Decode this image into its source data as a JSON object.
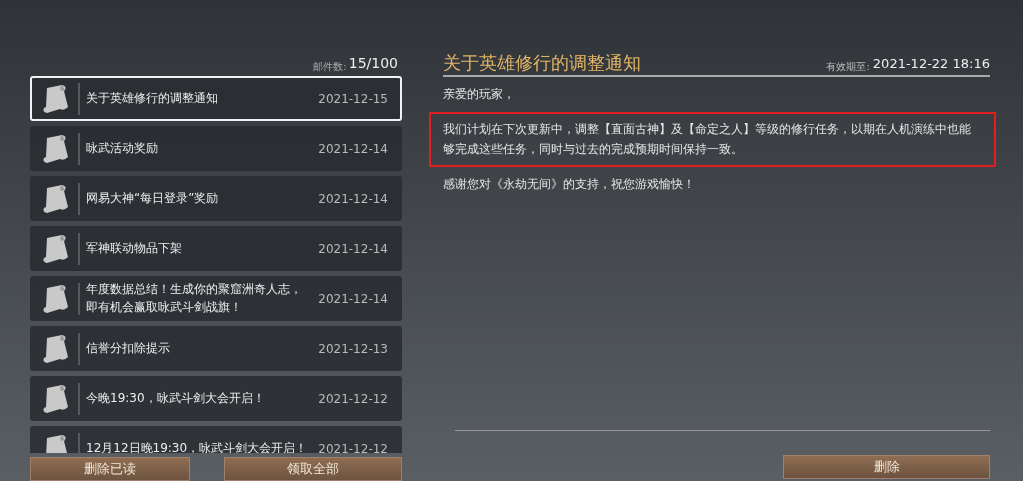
{
  "mail_list": {
    "count_label": "邮件数:",
    "count": "15/100",
    "items": [
      {
        "title": "关于英雄修行的调整通知",
        "date": "2021-12-15",
        "selected": true
      },
      {
        "title": "咏武活动奖励",
        "date": "2021-12-14",
        "selected": false
      },
      {
        "title": "网易大神“每日登录”奖励",
        "date": "2021-12-14",
        "selected": false
      },
      {
        "title": "军神联动物品下架",
        "date": "2021-12-14",
        "selected": false
      },
      {
        "title": "年度数据总结！生成你的聚窟洲奇人志，即有机会赢取咏武斗剑战旗！",
        "date": "2021-12-14",
        "selected": false
      },
      {
        "title": "信誉分扣除提示",
        "date": "2021-12-13",
        "selected": false
      },
      {
        "title": "今晚19:30，咏武斗剑大会开启！",
        "date": "2021-12-12",
        "selected": false
      },
      {
        "title": "12月12日晚19:30，咏武斗剑大会开启！",
        "date": "2021-12-12",
        "selected": false
      }
    ],
    "buttons": [
      "删除已读",
      "领取全部"
    ]
  },
  "mail_detail": {
    "title": "关于英雄修行的调整通知",
    "expiry_label": "有效期至:",
    "expiry": "2021-12-22 18:16",
    "paragraphs": [
      {
        "text": "亲爱的玩家，",
        "highlighted": false
      },
      {
        "text": "我们计划在下次更新中，调整【直面古神】及【命定之人】等级的修行任务，以期在人机演练中也能够完成这些任务，同时与过去的完成预期时间保持一致。",
        "highlighted": true
      },
      {
        "text": "感谢您对《永劫无间》的支持，祝您游戏愉快！",
        "highlighted": false
      }
    ],
    "button": "删除"
  }
}
